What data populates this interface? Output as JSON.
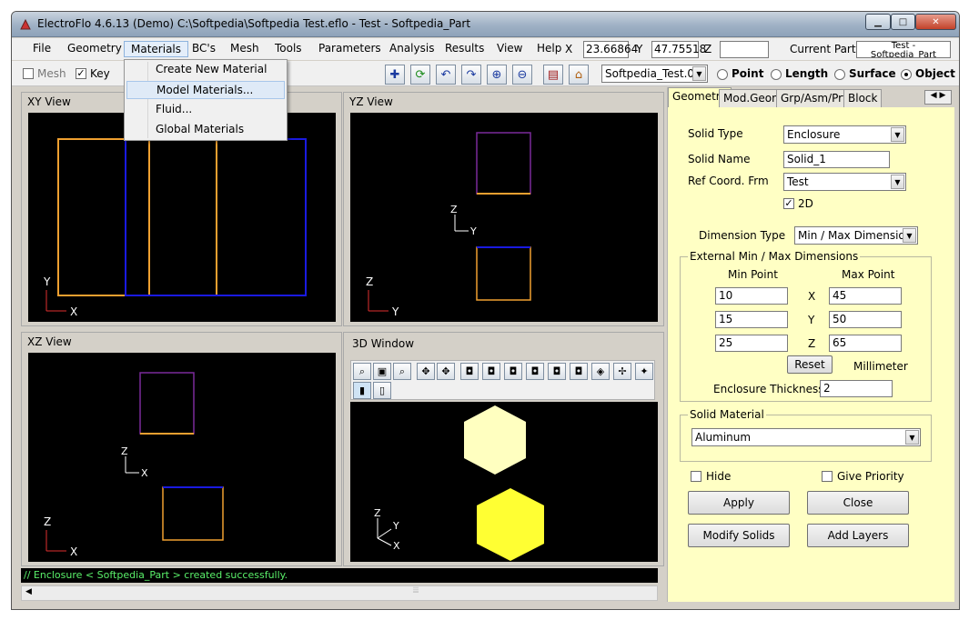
{
  "window": {
    "title": "ElectroFlo 4.6.13 (Demo)    C:\\Softpedia\\Softpedia Test.eflo   -  Test - Softpedia_Part"
  },
  "menu": {
    "items": [
      "File",
      "Geometry",
      "Materials",
      "BC's",
      "Mesh",
      "Tools",
      "Parameters",
      "Analysis",
      "Results",
      "View",
      "Help"
    ],
    "active": "Materials",
    "dropdown": [
      "Create New Material",
      "Model Materials...",
      "Fluid...",
      "Global Materials"
    ],
    "highlighted": "Model Materials..."
  },
  "coords": {
    "x_label": "X",
    "x_value": "23.66864",
    "y_label": "Y",
    "y_value": "47.75518",
    "z_label": "Z",
    "z_value": "",
    "current_part_label": "Current Part:",
    "current_part_value": "Test - Softpedia_Part"
  },
  "toolbar": {
    "mesh_label": "Mesh",
    "mesh_checked": false,
    "key_label": "Key",
    "key_checked": true,
    "part_select": "Softpedia_Test.0",
    "modes": [
      "Point",
      "Length",
      "Surface",
      "Object"
    ],
    "selected_mode": "Object"
  },
  "views": {
    "xy": "XY View",
    "yz": "YZ View",
    "xz": "XZ View",
    "w3d": "3D Window"
  },
  "axes": {
    "x": "X",
    "y": "Y",
    "z": "Z"
  },
  "colors": {
    "orange": "#f0a030",
    "blue": "#1a1ae0",
    "purple": "#7a2a9a",
    "hex_light": "#ffffc0",
    "hex_yellow": "#ffff33",
    "status_green": "#5af06a"
  },
  "status": "// Enclosure < Softpedia_Part > created successfully.",
  "panel": {
    "tabs": [
      "Geometry",
      "Mod.Geom",
      "Grp/Asm/Prt",
      "Block"
    ],
    "active_tab": "Geometry",
    "solid_type_label": "Solid Type",
    "solid_type": "Enclosure",
    "solid_name_label": "Solid Name",
    "solid_name": "Solid_1",
    "ref_coord_label": "Ref Coord. Frm",
    "ref_coord": "Test",
    "twod_label": "2D",
    "twod_checked": true,
    "dim_type_label": "Dimension Type",
    "dim_type": "Min / Max Dimension",
    "ext_group": "External Min / Max Dimensions",
    "min_point": "Min Point",
    "max_point": "Max Point",
    "min": [
      "10",
      "15",
      "25"
    ],
    "max": [
      "45",
      "50",
      "65"
    ],
    "axis_labels": [
      "X",
      "Y",
      "Z"
    ],
    "reset": "Reset",
    "units": "Millimeter",
    "thickness_label": "Enclosure Thickness",
    "thickness": "2",
    "material_group": "Solid Material",
    "material": "Aluminum",
    "hide_label": "Hide",
    "hide_checked": false,
    "priority_label": "Give Priority",
    "priority_checked": false,
    "apply": "Apply",
    "close": "Close",
    "modify": "Modify Solids",
    "layers": "Add Layers"
  }
}
